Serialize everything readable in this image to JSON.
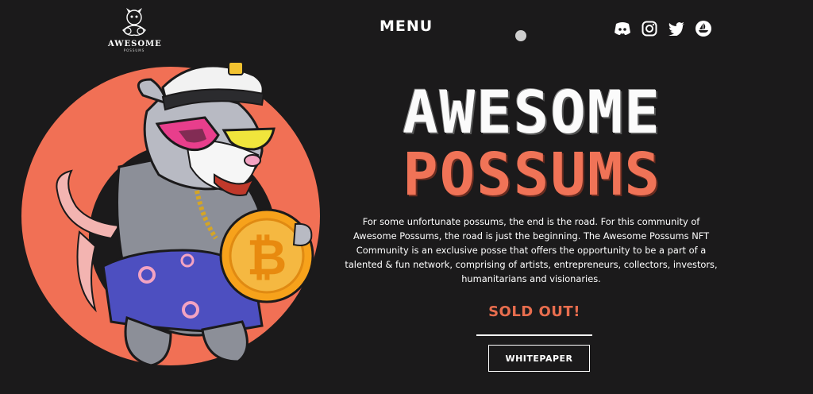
{
  "logo": {
    "name": "AWESOME",
    "sub": "POSSUMS"
  },
  "nav": {
    "menu_label": "MENU"
  },
  "socials": [
    {
      "icon": "discord-icon"
    },
    {
      "icon": "instagram-icon"
    },
    {
      "icon": "twitter-icon"
    },
    {
      "icon": "opensea-icon"
    }
  ],
  "hero": {
    "title_line1": "AWESOME",
    "title_line2": "POSSUMS",
    "description": "For some unfortunate possums, the end is the road. For this community of Awesome Possums, the road is just the beginning. The Awesome Possums NFT Community is an exclusive posse that offers the opportunity to be a part of a talented & fun network, comprising of artists, entrepreneurs, collectors, investors, humanitarians and visionaries.",
    "status": "SOLD OUT!",
    "cta_label": "WHITEPAPER"
  },
  "colors": {
    "background": "#1b1a1b",
    "accent": "#f07357",
    "circle": "#f17055",
    "coin": "#f7a21b"
  }
}
